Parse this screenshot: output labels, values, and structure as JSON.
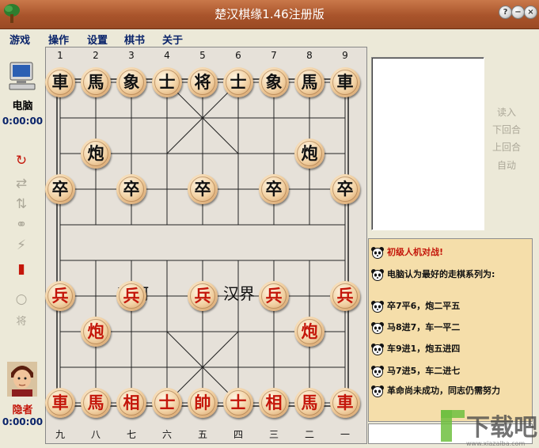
{
  "window": {
    "title": "楚汉棋缘1.46注册版",
    "buttons": [
      "?",
      "−",
      "×"
    ]
  },
  "menu": [
    "游戏",
    "操作",
    "设置",
    "棋书",
    "关于"
  ],
  "players": {
    "top": {
      "name": "电脑",
      "timer": "0:00:00"
    },
    "bottom": {
      "name": "隐者",
      "timer": "0:00:00"
    }
  },
  "toolbar_icons": [
    "undo-icon",
    "swap-horizontal-icon",
    "swap-vertical-icon",
    "link-icon",
    "lightning-icon",
    "exit-door-icon",
    "empty-piece-icon",
    "general-piece-icon"
  ],
  "toolbar_glyphs": [
    "↻",
    "⇄",
    "⇅",
    "⚭",
    "⚡",
    "▮",
    "○",
    "将"
  ],
  "board": {
    "top_files": [
      "1",
      "2",
      "3",
      "4",
      "5",
      "6",
      "7",
      "8",
      "9"
    ],
    "bottom_files": [
      "九",
      "八",
      "七",
      "六",
      "五",
      "四",
      "三",
      "二",
      "一"
    ],
    "river": {
      "left": "楚河",
      "right": "汉界"
    },
    "pieces": [
      {
        "char": "車",
        "side": "black",
        "col": 0,
        "row": 0
      },
      {
        "char": "馬",
        "side": "black",
        "col": 1,
        "row": 0
      },
      {
        "char": "象",
        "side": "black",
        "col": 2,
        "row": 0
      },
      {
        "char": "士",
        "side": "black",
        "col": 3,
        "row": 0
      },
      {
        "char": "将",
        "side": "black",
        "col": 4,
        "row": 0
      },
      {
        "char": "士",
        "side": "black",
        "col": 5,
        "row": 0
      },
      {
        "char": "象",
        "side": "black",
        "col": 6,
        "row": 0
      },
      {
        "char": "馬",
        "side": "black",
        "col": 7,
        "row": 0
      },
      {
        "char": "車",
        "side": "black",
        "col": 8,
        "row": 0
      },
      {
        "char": "炮",
        "side": "black",
        "col": 1,
        "row": 2
      },
      {
        "char": "炮",
        "side": "black",
        "col": 7,
        "row": 2
      },
      {
        "char": "卒",
        "side": "black",
        "col": 0,
        "row": 3
      },
      {
        "char": "卒",
        "side": "black",
        "col": 2,
        "row": 3
      },
      {
        "char": "卒",
        "side": "black",
        "col": 4,
        "row": 3
      },
      {
        "char": "卒",
        "side": "black",
        "col": 6,
        "row": 3
      },
      {
        "char": "卒",
        "side": "black",
        "col": 8,
        "row": 3
      },
      {
        "char": "兵",
        "side": "red",
        "col": 0,
        "row": 6
      },
      {
        "char": "兵",
        "side": "red",
        "col": 2,
        "row": 6
      },
      {
        "char": "兵",
        "side": "red",
        "col": 4,
        "row": 6
      },
      {
        "char": "兵",
        "side": "red",
        "col": 6,
        "row": 6
      },
      {
        "char": "兵",
        "side": "red",
        "col": 8,
        "row": 6
      },
      {
        "char": "炮",
        "side": "red",
        "col": 1,
        "row": 7
      },
      {
        "char": "炮",
        "side": "red",
        "col": 7,
        "row": 7
      },
      {
        "char": "車",
        "side": "red",
        "col": 0,
        "row": 9
      },
      {
        "char": "馬",
        "side": "red",
        "col": 1,
        "row": 9
      },
      {
        "char": "相",
        "side": "red",
        "col": 2,
        "row": 9
      },
      {
        "char": "士",
        "side": "red",
        "col": 3,
        "row": 9
      },
      {
        "char": "帥",
        "side": "red",
        "col": 4,
        "row": 9
      },
      {
        "char": "士",
        "side": "red",
        "col": 5,
        "row": 9
      },
      {
        "char": "相",
        "side": "red",
        "col": 6,
        "row": 9
      },
      {
        "char": "馬",
        "side": "red",
        "col": 7,
        "row": 9
      },
      {
        "char": "車",
        "side": "red",
        "col": 8,
        "row": 9
      }
    ]
  },
  "controls": [
    "读入",
    "下回合",
    "上回合",
    "自动"
  ],
  "chat": [
    {
      "text": "初级人机对战!",
      "color": "#c4160a"
    },
    {
      "text": "电脑认为最好的走棋系列为:",
      "color": "#111111"
    },
    {
      "text": "卒7平6，炮二平五",
      "color": "#111111"
    },
    {
      "text": "马8进7，车一平二",
      "color": "#111111"
    },
    {
      "text": "车9进1，炮五进四",
      "color": "#111111"
    },
    {
      "text": "马7进5，车二进七",
      "color": "#111111"
    },
    {
      "text": "革命尚未成功，同志仍需努力",
      "color": "#111111"
    }
  ],
  "watermark": {
    "main": "下载吧",
    "sub": "www.xiazaiba.com"
  },
  "colors": {
    "red_piece": "#c4160a",
    "black_piece": "#111111",
    "title_bar": "#a9542b",
    "menu_text": "#0a246a",
    "chat_bg": "#f5deaa"
  }
}
